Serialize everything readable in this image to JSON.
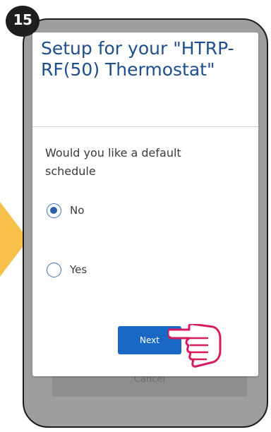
{
  "step_badge": "15",
  "dialog": {
    "title": "Setup for your \"HTRP-RF(50) Thermostat\"",
    "question": "Would you like a default schedule",
    "options": [
      {
        "label": "No",
        "selected": true
      },
      {
        "label": "Yes",
        "selected": false
      }
    ],
    "next_label": "Next"
  },
  "background": {
    "cancel_label": "Cancel"
  },
  "colors": {
    "title": "#1d4f8d",
    "next_button": "#1868c4",
    "radio": "#2a5fa8",
    "pointer_arrow": "#f7c04a",
    "hand_outline": "#d81b60",
    "step_badge": "#1e1e1e",
    "phone_overlay": "#9e9e9e"
  },
  "icons": {
    "pointer": "arrow-right-icon",
    "hand": "pointing-hand-icon",
    "radio_checked": "radio-checked-icon",
    "radio_unchecked": "radio-unchecked-icon"
  }
}
